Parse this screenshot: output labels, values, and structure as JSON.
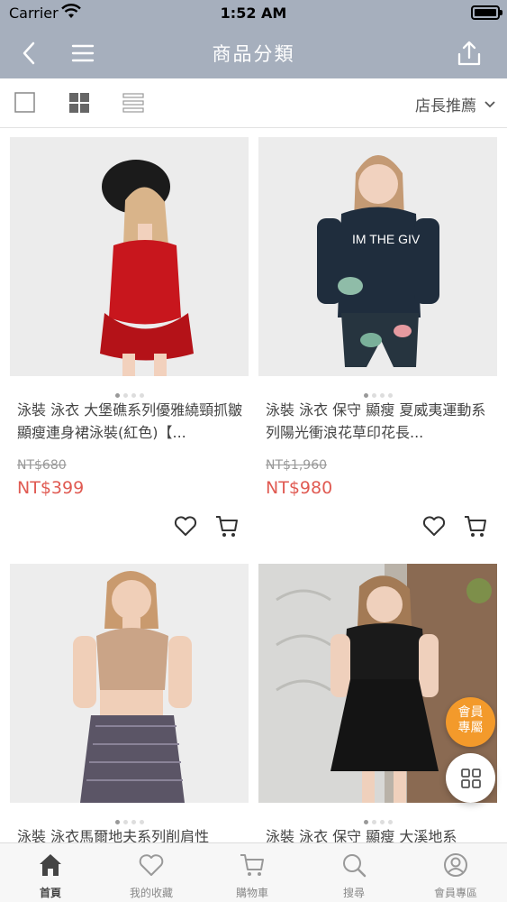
{
  "status_bar": {
    "carrier": "Carrier",
    "time": "1:52 AM"
  },
  "nav": {
    "title": "商品分類"
  },
  "toolbar": {
    "sort_label": "店長推薦"
  },
  "products": [
    {
      "name": "泳裝 泳衣 大堡礁系列優雅繞頸抓皺顯瘦連身裙泳裝(紅色)【...",
      "old_price": "NT$680",
      "price": "NT$399",
      "color": "#c8161d"
    },
    {
      "name": "泳裝 泳衣 保守 顯瘦 夏威夷運動系列陽光衝浪花草印花長...",
      "old_price": "NT$1,960",
      "price": "NT$980",
      "color": "#1f2d3d"
    },
    {
      "name": "泳裝 泳衣馬爾地夫系列削肩性",
      "old_price": "",
      "price": "",
      "color": "#caa487"
    },
    {
      "name": "泳裝 泳衣 保守 顯瘦 大溪地系",
      "old_price": "",
      "price": "",
      "color": "#1a1a1a"
    }
  ],
  "floating": {
    "member_label_1": "會員",
    "member_label_2": "專屬"
  },
  "tabs": [
    {
      "label": "首頁",
      "icon": "home-icon"
    },
    {
      "label": "我的收藏",
      "icon": "heart-icon"
    },
    {
      "label": "購物車",
      "icon": "cart-icon"
    },
    {
      "label": "搜尋",
      "icon": "search-icon"
    },
    {
      "label": "會員專區",
      "icon": "user-icon"
    }
  ],
  "colors": {
    "header": "#a6afbd",
    "price": "#e05a52",
    "member_badge": "#f39a2b"
  }
}
